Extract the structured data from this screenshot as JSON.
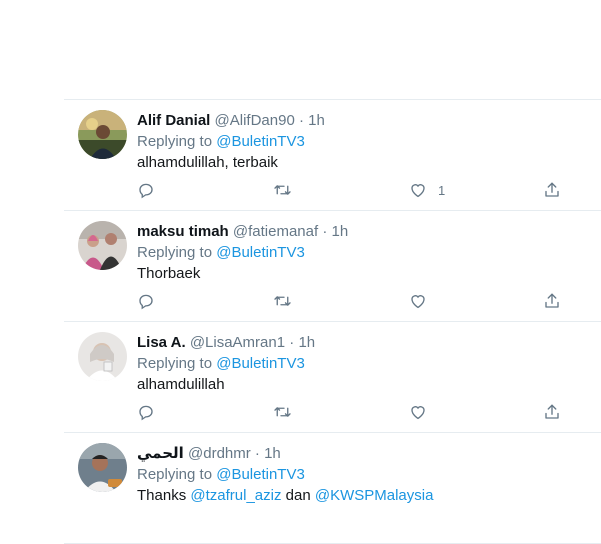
{
  "replies": [
    {
      "name": "Alif Danial",
      "handle": "@AlifDan90",
      "separator": "·",
      "time": "1h",
      "replying_prefix": "Replying to",
      "replying_to": "@BuletinTV3",
      "text": "alhamdulillah, terbaik",
      "like_count": "1"
    },
    {
      "name": "maksu timah",
      "handle": "@fatiemanaf",
      "separator": "·",
      "time": "1h",
      "replying_prefix": "Replying to",
      "replying_to": "@BuletinTV3",
      "text": "Thorbaek",
      "like_count": ""
    },
    {
      "name": "Lisa A.",
      "handle": "@LisaAmran1",
      "separator": "·",
      "time": "1h",
      "replying_prefix": "Replying to",
      "replying_to": "@BuletinTV3",
      "text": "alhamdulillah",
      "like_count": ""
    },
    {
      "name": "الحمي",
      "handle": "@drdhmr",
      "separator": "·",
      "time": "1h",
      "replying_prefix": "Replying to",
      "replying_to": "@BuletinTV3",
      "text_prefix": "Thanks",
      "mention_1": "@tzafrul_aziz",
      "text_middle": "dan",
      "mention_2": "@KWSPMalaysia"
    }
  ],
  "colors": {
    "link": "#1b95e0",
    "secondary": "#657786",
    "border": "#e6ecf0",
    "icon": "#657786"
  },
  "icons": [
    "reply-icon",
    "retweet-icon",
    "like-icon",
    "share-icon"
  ]
}
